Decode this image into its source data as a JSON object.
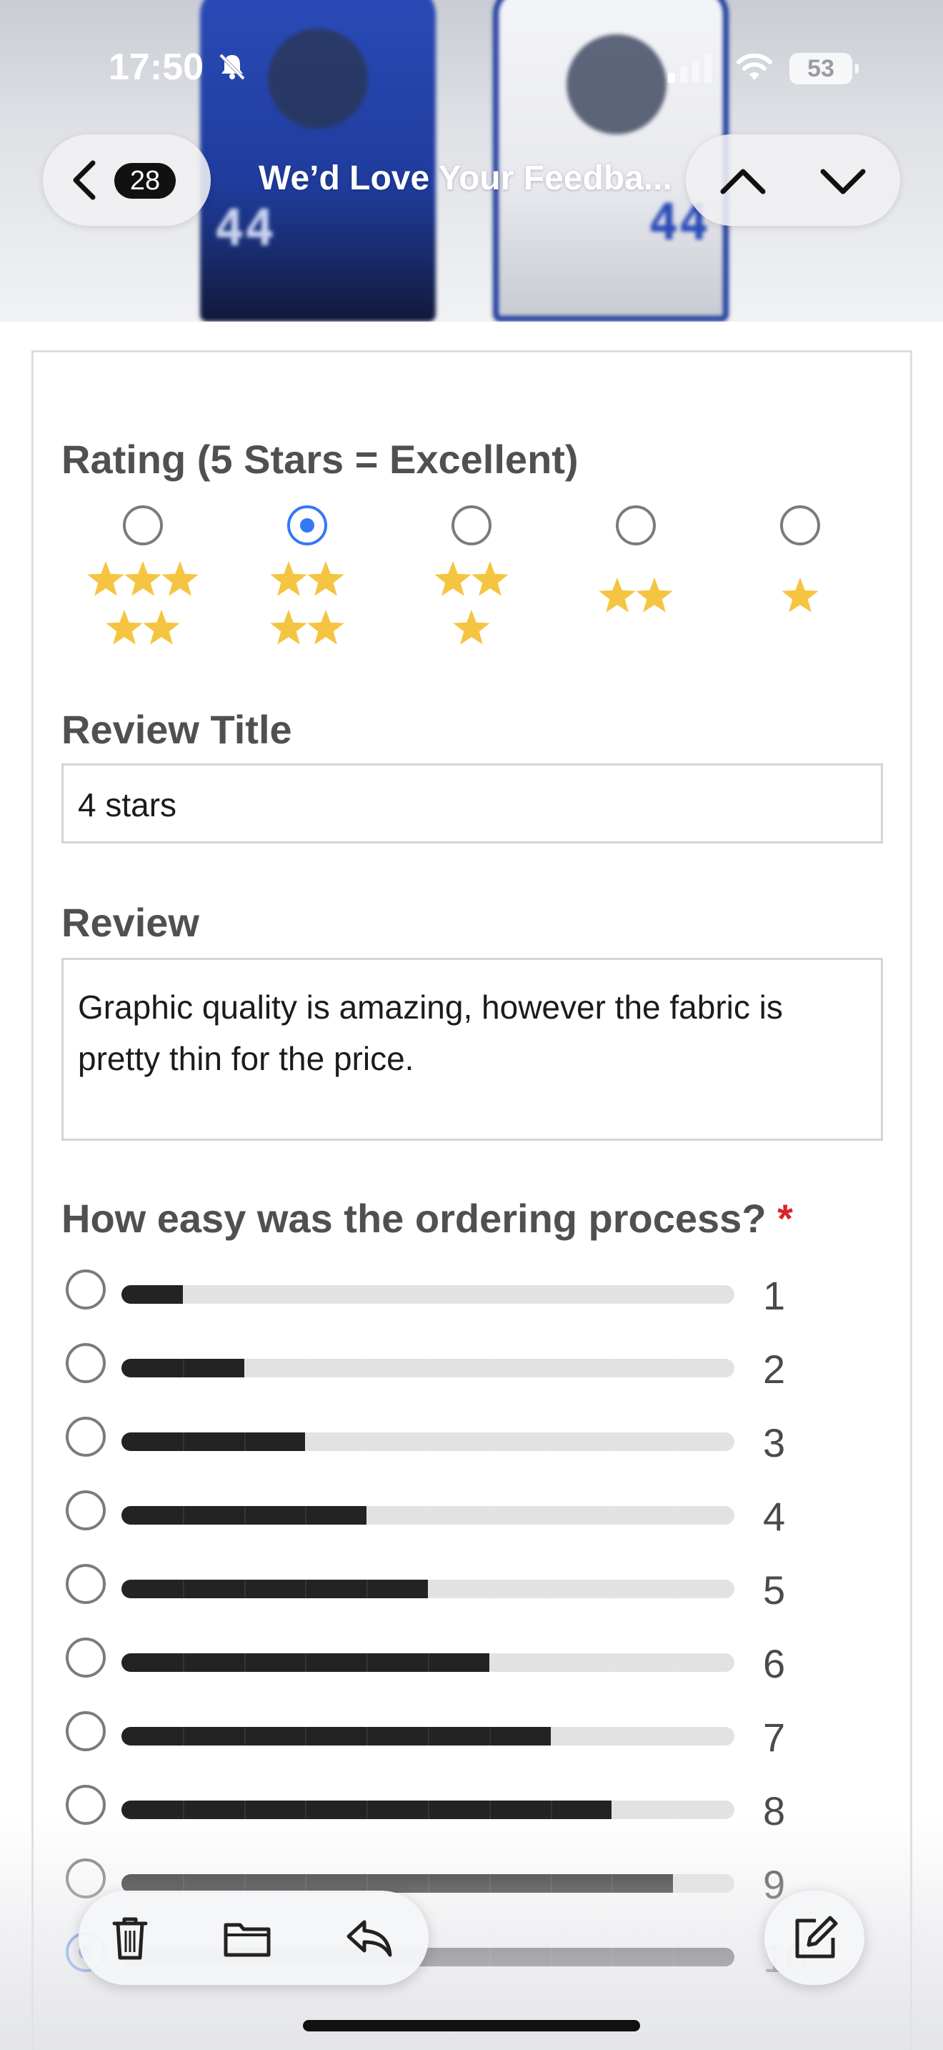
{
  "status_bar": {
    "time": "17:50",
    "battery": "53"
  },
  "nav": {
    "message_count": "28",
    "title": "We’d Love Your Feedba..."
  },
  "form": {
    "rating": {
      "label": "Rating (5 Stars = Excellent)",
      "selected": "4 stars",
      "options": [
        {
          "stars": 5,
          "selected": false
        },
        {
          "stars": 4,
          "selected": true
        },
        {
          "stars": 3,
          "selected": false
        },
        {
          "stars": 2,
          "selected": false
        },
        {
          "stars": 1,
          "selected": false
        }
      ]
    },
    "review_title": {
      "label": "Review Title",
      "value": "4 stars"
    },
    "review": {
      "label": "Review",
      "value": "Graphic quality is amazing, however the fabric is pretty thin for the price."
    },
    "ordering": {
      "label": "How easy was the ordering process?",
      "required_marker": "*",
      "options": [
        {
          "value": "1",
          "fill": 0.1
        },
        {
          "value": "2",
          "fill": 0.2
        },
        {
          "value": "3",
          "fill": 0.3
        },
        {
          "value": "4",
          "fill": 0.4
        },
        {
          "value": "5",
          "fill": 0.5
        },
        {
          "value": "6",
          "fill": 0.6
        },
        {
          "value": "7",
          "fill": 0.7
        },
        {
          "value": "8",
          "fill": 0.8
        },
        {
          "value": "9",
          "fill": 0.9
        },
        {
          "value": "10",
          "fill": 1.0,
          "selected": true
        }
      ]
    }
  },
  "colors": {
    "accent": "#3478f6",
    "star": "#f5c542",
    "required": "#d8232a"
  },
  "toolbar": {
    "icons": [
      "trash-icon",
      "folder-icon",
      "reply-icon",
      "compose-icon"
    ]
  }
}
